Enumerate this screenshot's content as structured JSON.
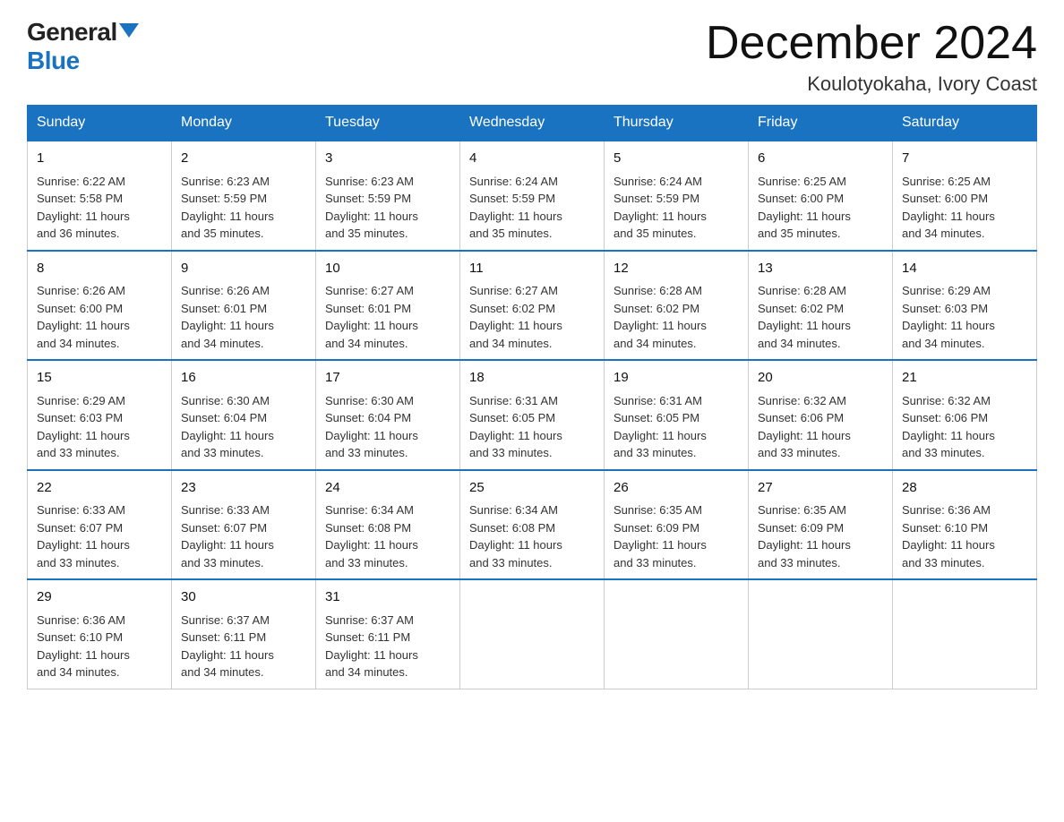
{
  "logo": {
    "general": "General",
    "blue": "Blue"
  },
  "title": "December 2024",
  "location": "Koulotyokaha, Ivory Coast",
  "weekdays": [
    "Sunday",
    "Monday",
    "Tuesday",
    "Wednesday",
    "Thursday",
    "Friday",
    "Saturday"
  ],
  "weeks": [
    [
      {
        "day": "1",
        "sunrise": "6:22 AM",
        "sunset": "5:58 PM",
        "daylight": "11 hours and 36 minutes."
      },
      {
        "day": "2",
        "sunrise": "6:23 AM",
        "sunset": "5:59 PM",
        "daylight": "11 hours and 35 minutes."
      },
      {
        "day": "3",
        "sunrise": "6:23 AM",
        "sunset": "5:59 PM",
        "daylight": "11 hours and 35 minutes."
      },
      {
        "day": "4",
        "sunrise": "6:24 AM",
        "sunset": "5:59 PM",
        "daylight": "11 hours and 35 minutes."
      },
      {
        "day": "5",
        "sunrise": "6:24 AM",
        "sunset": "5:59 PM",
        "daylight": "11 hours and 35 minutes."
      },
      {
        "day": "6",
        "sunrise": "6:25 AM",
        "sunset": "6:00 PM",
        "daylight": "11 hours and 35 minutes."
      },
      {
        "day": "7",
        "sunrise": "6:25 AM",
        "sunset": "6:00 PM",
        "daylight": "11 hours and 34 minutes."
      }
    ],
    [
      {
        "day": "8",
        "sunrise": "6:26 AM",
        "sunset": "6:00 PM",
        "daylight": "11 hours and 34 minutes."
      },
      {
        "day": "9",
        "sunrise": "6:26 AM",
        "sunset": "6:01 PM",
        "daylight": "11 hours and 34 minutes."
      },
      {
        "day": "10",
        "sunrise": "6:27 AM",
        "sunset": "6:01 PM",
        "daylight": "11 hours and 34 minutes."
      },
      {
        "day": "11",
        "sunrise": "6:27 AM",
        "sunset": "6:02 PM",
        "daylight": "11 hours and 34 minutes."
      },
      {
        "day": "12",
        "sunrise": "6:28 AM",
        "sunset": "6:02 PM",
        "daylight": "11 hours and 34 minutes."
      },
      {
        "day": "13",
        "sunrise": "6:28 AM",
        "sunset": "6:02 PM",
        "daylight": "11 hours and 34 minutes."
      },
      {
        "day": "14",
        "sunrise": "6:29 AM",
        "sunset": "6:03 PM",
        "daylight": "11 hours and 34 minutes."
      }
    ],
    [
      {
        "day": "15",
        "sunrise": "6:29 AM",
        "sunset": "6:03 PM",
        "daylight": "11 hours and 33 minutes."
      },
      {
        "day": "16",
        "sunrise": "6:30 AM",
        "sunset": "6:04 PM",
        "daylight": "11 hours and 33 minutes."
      },
      {
        "day": "17",
        "sunrise": "6:30 AM",
        "sunset": "6:04 PM",
        "daylight": "11 hours and 33 minutes."
      },
      {
        "day": "18",
        "sunrise": "6:31 AM",
        "sunset": "6:05 PM",
        "daylight": "11 hours and 33 minutes."
      },
      {
        "day": "19",
        "sunrise": "6:31 AM",
        "sunset": "6:05 PM",
        "daylight": "11 hours and 33 minutes."
      },
      {
        "day": "20",
        "sunrise": "6:32 AM",
        "sunset": "6:06 PM",
        "daylight": "11 hours and 33 minutes."
      },
      {
        "day": "21",
        "sunrise": "6:32 AM",
        "sunset": "6:06 PM",
        "daylight": "11 hours and 33 minutes."
      }
    ],
    [
      {
        "day": "22",
        "sunrise": "6:33 AM",
        "sunset": "6:07 PM",
        "daylight": "11 hours and 33 minutes."
      },
      {
        "day": "23",
        "sunrise": "6:33 AM",
        "sunset": "6:07 PM",
        "daylight": "11 hours and 33 minutes."
      },
      {
        "day": "24",
        "sunrise": "6:34 AM",
        "sunset": "6:08 PM",
        "daylight": "11 hours and 33 minutes."
      },
      {
        "day": "25",
        "sunrise": "6:34 AM",
        "sunset": "6:08 PM",
        "daylight": "11 hours and 33 minutes."
      },
      {
        "day": "26",
        "sunrise": "6:35 AM",
        "sunset": "6:09 PM",
        "daylight": "11 hours and 33 minutes."
      },
      {
        "day": "27",
        "sunrise": "6:35 AM",
        "sunset": "6:09 PM",
        "daylight": "11 hours and 33 minutes."
      },
      {
        "day": "28",
        "sunrise": "6:36 AM",
        "sunset": "6:10 PM",
        "daylight": "11 hours and 33 minutes."
      }
    ],
    [
      {
        "day": "29",
        "sunrise": "6:36 AM",
        "sunset": "6:10 PM",
        "daylight": "11 hours and 34 minutes."
      },
      {
        "day": "30",
        "sunrise": "6:37 AM",
        "sunset": "6:11 PM",
        "daylight": "11 hours and 34 minutes."
      },
      {
        "day": "31",
        "sunrise": "6:37 AM",
        "sunset": "6:11 PM",
        "daylight": "11 hours and 34 minutes."
      },
      null,
      null,
      null,
      null
    ]
  ]
}
